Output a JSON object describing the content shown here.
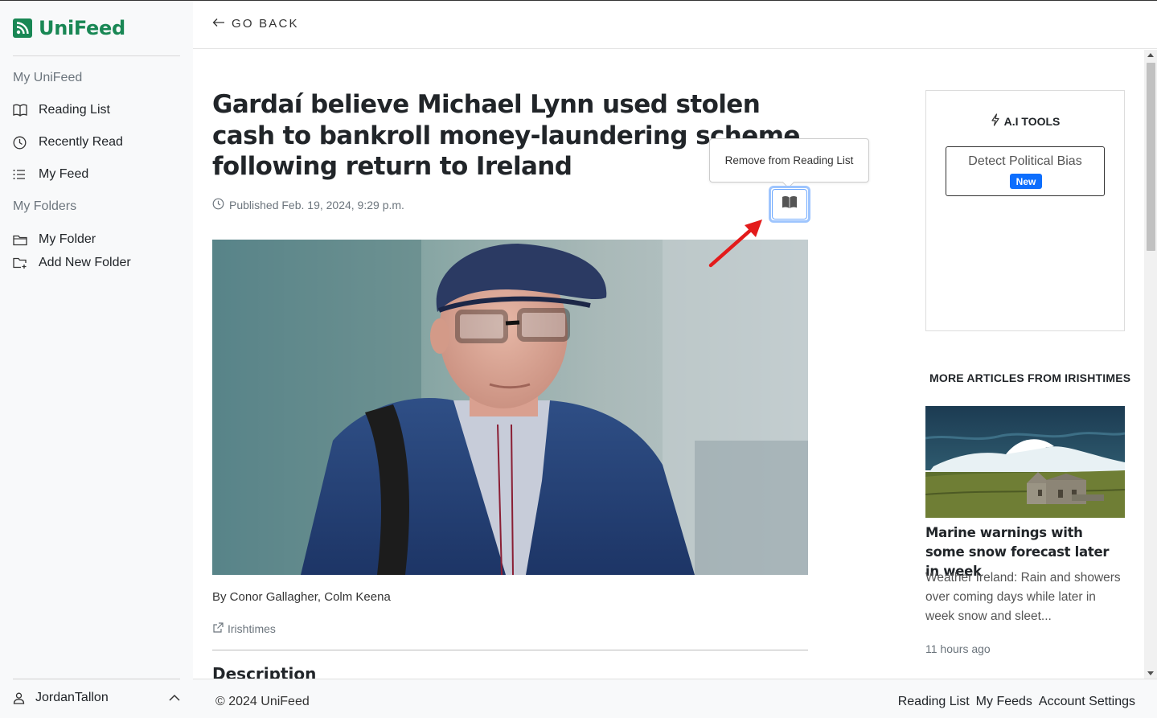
{
  "app": {
    "name": "UniFeed"
  },
  "sidebar": {
    "heading_main": "My UniFeed",
    "items": [
      {
        "label": "Reading List",
        "icon": "book-icon"
      },
      {
        "label": "Recently Read",
        "icon": "clock-icon"
      },
      {
        "label": "My Feed",
        "icon": "list-icon"
      }
    ],
    "heading_folders": "My Folders",
    "folders": [
      {
        "label": "My Folder",
        "icon": "folder-icon"
      },
      {
        "label": "Add New Folder",
        "icon": "folder-plus-icon"
      }
    ],
    "user": "JordanTallon"
  },
  "topbar": {
    "back_label": "GO BACK"
  },
  "article": {
    "title": "Gardaí believe Michael Lynn used stolen cash to bankroll money-laundering scheme following return to Ireland",
    "published": "Published Feb. 19, 2024, 9:29 p.m.",
    "byline": "By Conor Gallagher, Colm Keena",
    "source": "Irishtimes",
    "section_heading": "Description"
  },
  "tooltip": {
    "text": "Remove from Reading List"
  },
  "ai_tools": {
    "title": "A.I TOOLS",
    "bias_button": "Detect Political Bias",
    "badge": "New"
  },
  "more_articles": {
    "heading": "MORE ARTICLES FROM IRISHTIMES",
    "items": [
      {
        "title": "Marine warnings with some snow forecast later in week",
        "description": "Weather Ireland: Rain and showers over coming days while later in week snow and sleet...",
        "time": "11 hours ago"
      }
    ]
  },
  "footer": {
    "copyright": "© 2024 UniFeed",
    "links": [
      "Reading List",
      "My Feeds",
      "Account Settings"
    ]
  },
  "colors": {
    "brand": "#198754",
    "badge": "#0d6efd",
    "focus_ring": "#9ec5fe",
    "arrow": "#e31b1b"
  }
}
